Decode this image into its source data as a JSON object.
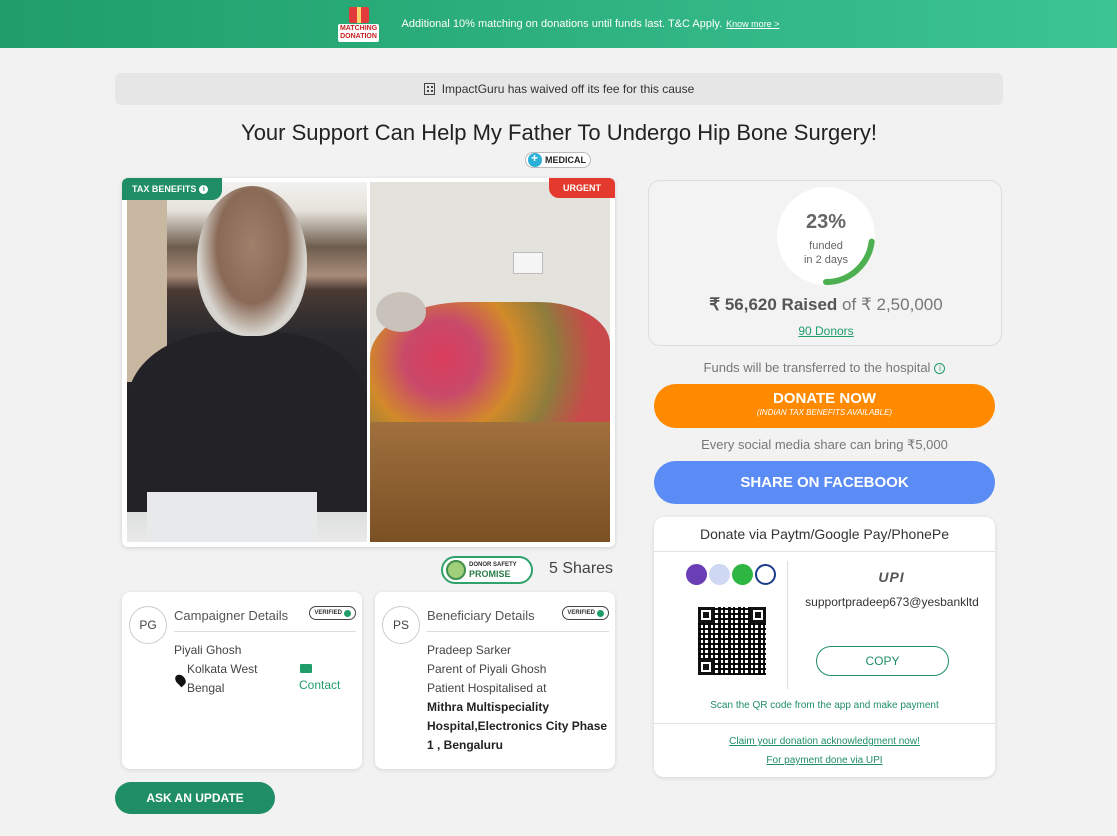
{
  "banner": {
    "badge_line1": "MATCHING",
    "badge_line2": "DONATION",
    "text": "Additional 10% matching on donations until funds last. T&C Apply.",
    "link": "Know more >"
  },
  "fee_notice": "ImpactGuru has waived off its fee for this cause",
  "campaign": {
    "title": "Your Support Can Help My Father To Undergo Hip Bone Surgery!",
    "category": "MEDICAL",
    "tag_tax": "TAX BENEFITS",
    "tag_urgent": "URGENT"
  },
  "safety_badge": {
    "top": "DONOR SAFETY",
    "main": "PROMISE"
  },
  "shares": "5  Shares",
  "campaigner": {
    "initials": "PG",
    "heading": "Campaigner Details",
    "verified": "VERIFIED",
    "name": "Piyali Ghosh",
    "location_line1": "Kolkata West",
    "location_line2": "Bengal",
    "contact": "Contact"
  },
  "beneficiary": {
    "initials": "PS",
    "heading": "Beneficiary Details",
    "verified": "VERIFIED",
    "name": "Pradeep Sarker",
    "relation": "Parent of Piyali Ghosh",
    "status": "Patient Hospitalised at",
    "hospital_line1": "Mithra Multispeciality",
    "hospital_line2": "Hospital,Electronics City Phase",
    "hospital_line3": "1 , Bengaluru"
  },
  "ask_update": "ASK AN UPDATE",
  "funding": {
    "percent_value": 23,
    "percent": "23%",
    "funded_label": "funded",
    "duration": "in 2 days",
    "raised": "₹ 56,620 Raised",
    "of": "of",
    "goal": "₹ 2,50,000",
    "donors": "90 Donors"
  },
  "funds_note": "Funds will be transferred to the hospital",
  "donate": {
    "label": "DONATE NOW",
    "sub": "(INDIAN TAX BENEFITS AVAILABLE)"
  },
  "social_note": "Every social media share can bring ₹5,000",
  "facebook_button": "SHARE ON FACEBOOK",
  "upi": {
    "title": "Donate via Paytm/Google Pay/PhonePe",
    "logo": "UPI",
    "id": "supportpradeep673@yesbankltd",
    "copy": "COPY",
    "scan_note": "Scan the QR code from the app and make payment",
    "claim_line1": "Claim your donation acknowledgment now!",
    "claim_line2": "For payment done via UPI"
  },
  "colors": {
    "brand_green": "#1f8e64",
    "donate_orange": "#ff8a00",
    "facebook_blue": "#5b8bf5",
    "urgent_red": "#e43a2d"
  }
}
